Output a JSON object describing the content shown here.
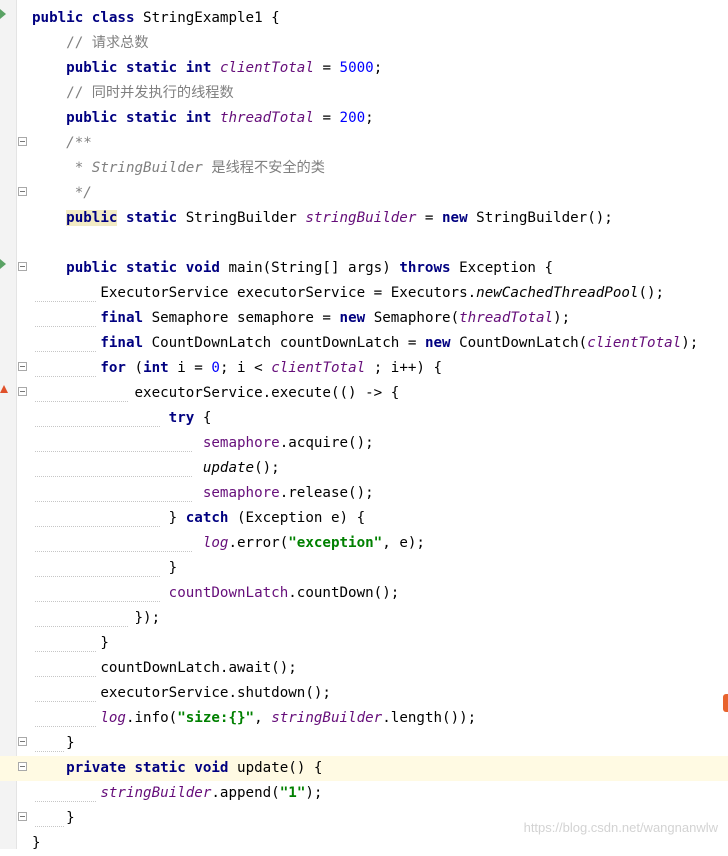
{
  "editor": {
    "language": "Java",
    "watermark": "https://blog.csdn.net/wangnanwlw",
    "colors": {
      "keyword": "#000080",
      "string": "#008000",
      "number": "#0000ff",
      "comment": "#808080",
      "static_field": "#660e7a",
      "current_line": "#fffae3"
    },
    "lines": [
      {
        "tokens": [
          {
            "t": "public",
            "c": "kw"
          },
          {
            "t": " "
          },
          {
            "t": "class",
            "c": "kw"
          },
          {
            "t": " StringExample1 {"
          }
        ],
        "icon": "run-icon"
      },
      {
        "tokens": [
          {
            "t": "    "
          },
          {
            "t": "// 请求总数",
            "c": "cmt"
          }
        ]
      },
      {
        "tokens": [
          {
            "t": "    "
          },
          {
            "t": "public",
            "c": "kw"
          },
          {
            "t": " "
          },
          {
            "t": "static",
            "c": "kw"
          },
          {
            "t": " "
          },
          {
            "t": "int",
            "c": "kw"
          },
          {
            "t": " "
          },
          {
            "t": "clientTotal",
            "c": "sf"
          },
          {
            "t": " = "
          },
          {
            "t": "5000",
            "c": "num"
          },
          {
            "t": ";"
          }
        ]
      },
      {
        "tokens": [
          {
            "t": "    "
          },
          {
            "t": "// 同时并发执行的线程数",
            "c": "cmt"
          }
        ]
      },
      {
        "tokens": [
          {
            "t": "    "
          },
          {
            "t": "public",
            "c": "kw"
          },
          {
            "t": " "
          },
          {
            "t": "static",
            "c": "kw"
          },
          {
            "t": " "
          },
          {
            "t": "int",
            "c": "kw"
          },
          {
            "t": " "
          },
          {
            "t": "threadTotal",
            "c": "sf"
          },
          {
            "t": " = "
          },
          {
            "t": "200",
            "c": "num"
          },
          {
            "t": ";"
          }
        ]
      },
      {
        "tokens": [
          {
            "t": "    "
          },
          {
            "t": "/**",
            "c": "cmt sm"
          }
        ],
        "fold": true
      },
      {
        "tokens": [
          {
            "t": "     "
          },
          {
            "t": "* StringBuilder",
            "c": "cmt sm"
          },
          {
            "t": " 是线程不安全的类",
            "c": "cmt"
          }
        ]
      },
      {
        "tokens": [
          {
            "t": "     "
          },
          {
            "t": "*/",
            "c": "cmt sm"
          }
        ],
        "fold": true
      },
      {
        "tokens": [
          {
            "t": "    "
          },
          {
            "t": "public",
            "c": "kw-hl"
          },
          {
            "t": " "
          },
          {
            "t": "static",
            "c": "kw"
          },
          {
            "t": " StringBuilder "
          },
          {
            "t": "stringBuilder",
            "c": "sf"
          },
          {
            "t": " = "
          },
          {
            "t": "new",
            "c": "kw"
          },
          {
            "t": " StringBuilder();"
          }
        ]
      },
      {
        "tokens": [
          {
            "t": ""
          }
        ]
      },
      {
        "tokens": [
          {
            "t": "    "
          },
          {
            "t": "public",
            "c": "kw"
          },
          {
            "t": " "
          },
          {
            "t": "static",
            "c": "kw"
          },
          {
            "t": " "
          },
          {
            "t": "void",
            "c": "kw"
          },
          {
            "t": " main(String[] args) "
          },
          {
            "t": "throws",
            "c": "kw"
          },
          {
            "t": " Exception {"
          }
        ],
        "icon": "run-icon",
        "fold": true
      },
      {
        "tokens": [
          {
            "t": "        ExecutorService executorService = Executors."
          },
          {
            "t": "newCachedThreadPool",
            "c": "sm"
          },
          {
            "t": "();"
          }
        ],
        "guide": [
          35,
          96
        ]
      },
      {
        "tokens": [
          {
            "t": "        "
          },
          {
            "t": "final",
            "c": "kw"
          },
          {
            "t": " Semaphore semaphore = "
          },
          {
            "t": "new",
            "c": "kw"
          },
          {
            "t": " Semaphore("
          },
          {
            "t": "threadTotal",
            "c": "sf"
          },
          {
            "t": ");"
          }
        ],
        "guide": [
          35,
          96
        ]
      },
      {
        "tokens": [
          {
            "t": "        "
          },
          {
            "t": "final",
            "c": "kw"
          },
          {
            "t": " CountDownLatch countDownLatch = "
          },
          {
            "t": "new",
            "c": "kw"
          },
          {
            "t": " CountDownLatch("
          },
          {
            "t": "clientTotal",
            "c": "sf"
          },
          {
            "t": ");"
          }
        ],
        "guide": [
          35,
          96
        ]
      },
      {
        "tokens": [
          {
            "t": "        "
          },
          {
            "t": "for",
            "c": "kw"
          },
          {
            "t": " ("
          },
          {
            "t": "int",
            "c": "kw"
          },
          {
            "t": " i = "
          },
          {
            "t": "0",
            "c": "num"
          },
          {
            "t": "; i < "
          },
          {
            "t": "clientTotal",
            "c": "sf"
          },
          {
            "t": " ; i++) {"
          }
        ],
        "guide": [
          35,
          96
        ],
        "fold": true
      },
      {
        "tokens": [
          {
            "t": "            executorService.execute(() -> {"
          }
        ],
        "guide": [
          35,
          128
        ],
        "icon": "up-arrow",
        "fold": true
      },
      {
        "tokens": [
          {
            "t": "                "
          },
          {
            "t": "try",
            "c": "kw"
          },
          {
            "t": " {"
          }
        ],
        "guide": [
          35,
          160
        ]
      },
      {
        "tokens": [
          {
            "t": "                    "
          },
          {
            "t": "semaphore",
            "c": "fld"
          },
          {
            "t": ".acquire();"
          }
        ],
        "guide": [
          35,
          192
        ]
      },
      {
        "tokens": [
          {
            "t": "                    "
          },
          {
            "t": "update",
            "c": "sm"
          },
          {
            "t": "();"
          }
        ],
        "guide": [
          35,
          192
        ]
      },
      {
        "tokens": [
          {
            "t": "                    "
          },
          {
            "t": "semaphore",
            "c": "fld"
          },
          {
            "t": ".release();"
          }
        ],
        "guide": [
          35,
          192
        ]
      },
      {
        "tokens": [
          {
            "t": "                } "
          },
          {
            "t": "catch",
            "c": "kw"
          },
          {
            "t": " (Exception e) {"
          }
        ],
        "guide": [
          35,
          160
        ]
      },
      {
        "tokens": [
          {
            "t": "                    "
          },
          {
            "t": "log",
            "c": "sf"
          },
          {
            "t": ".error("
          },
          {
            "t": "\"exception\"",
            "c": "str"
          },
          {
            "t": ", e);"
          }
        ],
        "guide": [
          35,
          192
        ]
      },
      {
        "tokens": [
          {
            "t": "                }"
          }
        ],
        "guide": [
          35,
          160
        ]
      },
      {
        "tokens": [
          {
            "t": "                "
          },
          {
            "t": "countDownLatch",
            "c": "fld"
          },
          {
            "t": ".countDown();"
          }
        ],
        "guide": [
          35,
          160
        ]
      },
      {
        "tokens": [
          {
            "t": "            });"
          }
        ],
        "guide": [
          35,
          128
        ]
      },
      {
        "tokens": [
          {
            "t": "        }"
          }
        ],
        "guide": [
          35,
          96
        ]
      },
      {
        "tokens": [
          {
            "t": "        countDownLatch.await();"
          }
        ],
        "guide": [
          35,
          96
        ]
      },
      {
        "tokens": [
          {
            "t": "        executorService.shutdown();"
          }
        ],
        "guide": [
          35,
          96
        ]
      },
      {
        "tokens": [
          {
            "t": "        "
          },
          {
            "t": "log",
            "c": "sf"
          },
          {
            "t": ".info("
          },
          {
            "t": "\"size:{}\"",
            "c": "str"
          },
          {
            "t": ", "
          },
          {
            "t": "stringBuilder",
            "c": "sf"
          },
          {
            "t": ".length());"
          }
        ],
        "guide": [
          35,
          96
        ]
      },
      {
        "tokens": [
          {
            "t": "    }"
          }
        ],
        "guide": [
          35,
          64
        ],
        "fold": true
      },
      {
        "tokens": [
          {
            "t": "    "
          },
          {
            "t": "private",
            "c": "kw"
          },
          {
            "t": " "
          },
          {
            "t": "static",
            "c": "kw"
          },
          {
            "t": " "
          },
          {
            "t": "void",
            "c": "kw"
          },
          {
            "t": " update() {"
          }
        ],
        "current": true,
        "fold": true
      },
      {
        "tokens": [
          {
            "t": "        "
          },
          {
            "t": "stringBuilder",
            "c": "sf"
          },
          {
            "t": ".append("
          },
          {
            "t": "\"1\"",
            "c": "str"
          },
          {
            "t": ");"
          }
        ],
        "guide": [
          35,
          96
        ]
      },
      {
        "tokens": [
          {
            "t": "    }"
          }
        ],
        "guide": [
          35,
          64
        ],
        "fold": true
      },
      {
        "tokens": [
          {
            "t": "}"
          }
        ]
      }
    ]
  }
}
